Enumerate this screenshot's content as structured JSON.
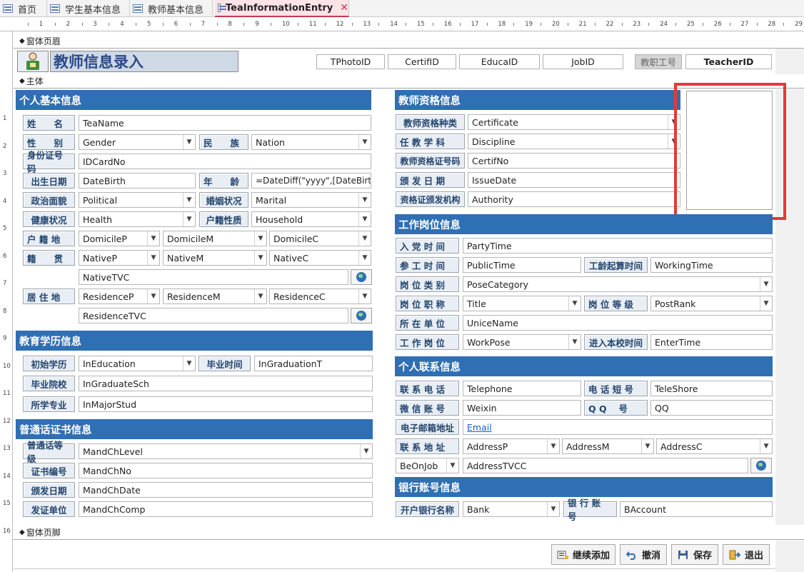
{
  "tabs": [
    {
      "label": "首页"
    },
    {
      "label": "学生基本信息"
    },
    {
      "label": "教师基本信息"
    },
    {
      "label": "TeaInformationEntry",
      "close": "✕"
    }
  ],
  "sections": {
    "header": "窗体页眉",
    "body": "主体",
    "footer": "窗体页脚"
  },
  "header": {
    "title": "教师信息录入",
    "fields": [
      "TPhotoID",
      "CertifID",
      "EducaID",
      "JobID"
    ],
    "job_no_label": "教职工号",
    "teacher_id": "TeacherID"
  },
  "groups": {
    "personal": "个人基本信息",
    "education": "教育学历信息",
    "mandarin": "普通话证书信息",
    "qualification": "教师资格信息",
    "job": "工作岗位信息",
    "contact": "个人联系信息",
    "bank": "银行账号信息"
  },
  "labels": {
    "name": "姓　　名",
    "gender": "性　　别",
    "nation": "民　　族",
    "idcard": "身份证号码",
    "birth": "出生日期",
    "age": "年　　龄",
    "political": "政治面貌",
    "marital": "婚姻状况",
    "health": "健康状况",
    "household": "户籍性质",
    "domicile": "户 籍 地",
    "native": "籍　　贯",
    "residence": "居 住 地",
    "in_edu": "初始学历",
    "grad_time": "毕业时间",
    "grad_school": "毕业院校",
    "major": "所学专业",
    "mand_level": "普通话等级",
    "cert_no": "证书编号",
    "issue_date": "颁发日期",
    "issuer": "发证单位",
    "cert_type": "教师资格种类",
    "discipline": "任 教 学 科",
    "cert_no2": "教师资格证号码",
    "issue_date2": "颁 发 日 期",
    "authority": "资格证颁发机构",
    "party_time": "入 党 时 间",
    "work_time": "参 工 时 间",
    "seniority_start": "工龄起算时间",
    "post_category": "岗 位 类 别",
    "post_title": "岗 位 职 称",
    "post_rank": "岗 位 等 级",
    "unit": "所 在 单 位",
    "work_post": "工 作 岗 位",
    "enter_time": "进入本校时间",
    "telephone": "联 系 电 话",
    "short_no": "电 话 短 号",
    "wechat": "微 信 账 号",
    "qq": "Q Q　 号",
    "email": "电子邮箱地址",
    "address": "联 系 地 址",
    "bank_name": "开户银行名称",
    "bank_account": "银 行 账 号"
  },
  "values": {
    "name": "TeaName",
    "gender": "Gender",
    "nation": "Nation",
    "idcard": "IDCardNo",
    "birth": "DateBirth",
    "age": "=DateDiff(\"yyyy\",[DateBirth]",
    "political": "Political",
    "marital": "Marital",
    "health": "Health",
    "household": "Household",
    "domicile_p": "DomicileP",
    "domicile_m": "DomicileM",
    "domicile_c": "DomicileC",
    "native_p": "NativeP",
    "native_m": "NativeM",
    "native_c": "NativeC",
    "native_tvc": "NativeTVC",
    "residence_p": "ResidenceP",
    "residence_m": "ResidenceM",
    "residence_c": "ResidenceC",
    "residence_tvc": "ResidenceTVC",
    "in_edu": "InEducation",
    "grad_time": "InGraduationT",
    "grad_school": "InGraduateSch",
    "major": "InMajorStud",
    "mand_level": "MandChLevel",
    "mand_no": "MandChNo",
    "mand_date": "MandChDate",
    "mand_comp": "MandChComp",
    "certificate": "Certificate",
    "discipline": "Discipline",
    "certif_no": "CertifNo",
    "issue_date": "IssueDate",
    "authority": "Authority",
    "party_time": "PartyTime",
    "public_time": "PublicTime",
    "working_time": "WorkingTime",
    "pose_category": "PoseCategory",
    "title": "Title",
    "post_rank": "PostRank",
    "unice_name": "UniceName",
    "work_pose": "WorkPose",
    "enter_time": "EnterTime",
    "telephone": "Telephone",
    "tele_shore": "TeleShore",
    "weixin": "Weixin",
    "qq": "QQ",
    "email": "Email",
    "address_p": "AddressP",
    "address_m": "AddressM",
    "address_c": "AddressC",
    "be_on_job": "BeOnJob",
    "address_tvcc": "AddressTVCC",
    "bank": "Bank",
    "b_account": "BAccount"
  },
  "footer_buttons": {
    "continue_add": "继续添加",
    "undo": "撤消",
    "save": "保存",
    "exit": "退出"
  },
  "colors": {
    "group_bar": "#2f6fb3",
    "title_text": "#2b4a86",
    "highlight": "#e53935",
    "active_tab": "#fbe3e6"
  },
  "ruler": {
    "h_marks": [
      "1",
      "2",
      "3",
      "4",
      "5",
      "6",
      "7",
      "8",
      "9",
      "10",
      "11",
      "12",
      "13",
      "14",
      "15",
      "16",
      "17",
      "18",
      "19",
      "20",
      "21",
      "22",
      "23",
      "24",
      "25",
      "26",
      "27",
      "28",
      "29"
    ],
    "v_marks": [
      "1",
      "2",
      "3",
      "4",
      "5",
      "6",
      "7",
      "8",
      "9",
      "10",
      "11",
      "12",
      "13",
      "14",
      "15",
      "16"
    ]
  }
}
